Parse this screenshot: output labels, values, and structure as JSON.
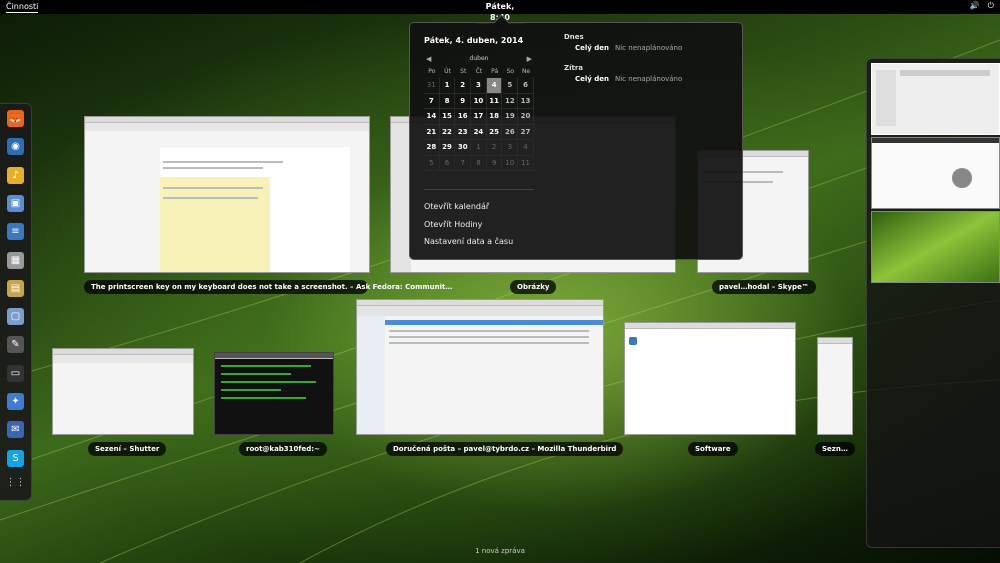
{
  "topbar": {
    "activities": "Činnosti",
    "clock": "Pátek,  8:40"
  },
  "dash": {
    "apps": [
      {
        "icon": "firefox-icon",
        "glyph": "🦊",
        "color": "#e8651a"
      },
      {
        "icon": "disk-icon",
        "glyph": "◉",
        "color": "#2c6eb5"
      },
      {
        "icon": "rhythmbox-icon",
        "glyph": "♪",
        "color": "#e5b12b"
      },
      {
        "icon": "desktop-icon",
        "glyph": "▣",
        "color": "#5b8dd6"
      },
      {
        "icon": "writer-icon",
        "glyph": "≡",
        "color": "#3a78c2"
      },
      {
        "icon": "calc-icon",
        "glyph": "▦",
        "color": "#999"
      },
      {
        "icon": "document-icon",
        "glyph": "▤",
        "color": "#c9a34a"
      },
      {
        "icon": "package-icon",
        "glyph": "▢",
        "color": "#7a9ecb"
      },
      {
        "icon": "shutter-icon",
        "glyph": "✎",
        "color": "#555"
      },
      {
        "icon": "terminal-icon",
        "glyph": "▭",
        "color": "#333"
      },
      {
        "icon": "software-icon",
        "glyph": "✦",
        "color": "#3f7bd0"
      },
      {
        "icon": "thunderbird-icon",
        "glyph": "✉",
        "color": "#3b66b5"
      },
      {
        "icon": "skype-icon",
        "glyph": "S",
        "color": "#15a3e8"
      }
    ]
  },
  "windows": [
    {
      "caption": "The printscreen key on my keyboard does not take a screenshot. – Ask Fedora: Communit…"
    },
    {
      "caption": "Obrázky"
    },
    {
      "caption": "pavel…hodal – Skype™"
    },
    {
      "caption": "Sezení – Shutter"
    },
    {
      "caption": "root@kab310fed:~"
    },
    {
      "caption": "Doručená pošta – pavel@tybrdo.cz – Mozilla Thunderbird"
    },
    {
      "caption": "Software"
    },
    {
      "caption": "Sezn…"
    }
  ],
  "calendar": {
    "date_title": "Pátek,  4. duben, 2014",
    "month": "duben",
    "weekdays": [
      "Po",
      "Út",
      "St",
      "Čt",
      "Pá",
      "So",
      "Ne"
    ],
    "weeks": [
      [
        "31",
        "1",
        "2",
        "3",
        "4",
        "5",
        "6"
      ],
      [
        "7",
        "8",
        "9",
        "10",
        "11",
        "12",
        "13"
      ],
      [
        "14",
        "15",
        "16",
        "17",
        "18",
        "19",
        "20"
      ],
      [
        "21",
        "22",
        "23",
        "24",
        "25",
        "26",
        "27"
      ],
      [
        "28",
        "29",
        "30",
        "1",
        "2",
        "3",
        "4"
      ],
      [
        "5",
        "6",
        "7",
        "8",
        "9",
        "10",
        "11"
      ]
    ],
    "today": "4",
    "events": {
      "today_header": "Dnes",
      "today_time": "Celý den",
      "today_text": "Nic nenaplánováno",
      "tomorrow_header": "Zítra",
      "tomorrow_time": "Celý den",
      "tomorrow_text": "Nic nenaplánováno"
    },
    "links": [
      "Otevřít kalendář",
      "Otevřít Hodiny",
      "Nastavení data a času"
    ]
  },
  "notification": "1 nová zpráva"
}
